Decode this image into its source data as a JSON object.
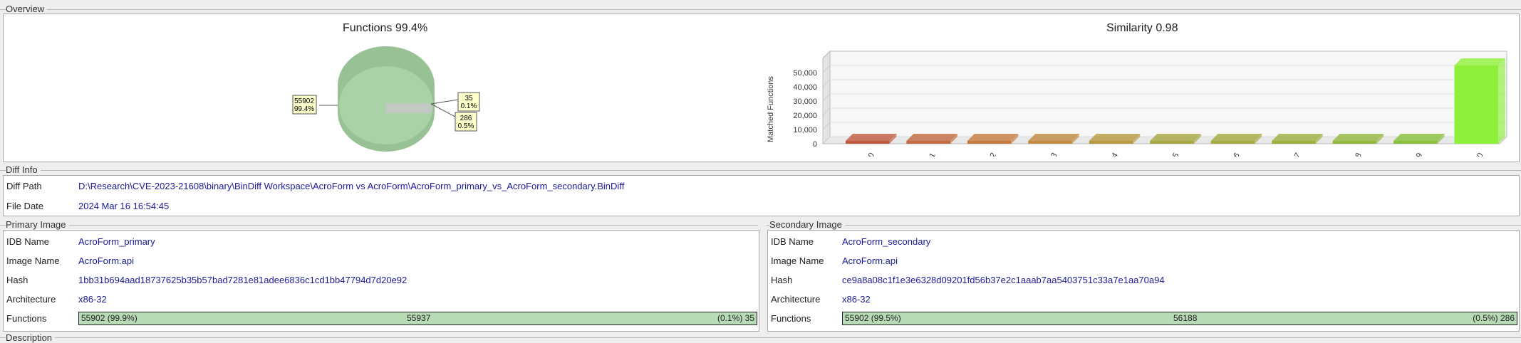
{
  "overview": {
    "section_title": "Overview",
    "functions_chart": {
      "title": "Functions 99.4%",
      "callouts": [
        {
          "count": "55902",
          "pct": "99.4%"
        },
        {
          "count": "35",
          "pct": "0.1%"
        },
        {
          "count": "286",
          "pct": "0.5%"
        }
      ]
    },
    "similarity_chart": {
      "title": "Similarity 0.98",
      "ylabel": "Matched Functions",
      "yticks": [
        "0",
        "10,000",
        "20,000",
        "30,000",
        "40,000",
        "50,000"
      ]
    }
  },
  "chart_data": [
    {
      "type": "pie",
      "title": "Functions 99.4%",
      "slices": [
        {
          "value": 55902,
          "percent": 99.4,
          "color": "#a9d3a6"
        },
        {
          "value": 35,
          "percent": 0.1,
          "color": "#c8c8c8"
        },
        {
          "value": 286,
          "percent": 0.5,
          "color": "#bdbdbd"
        }
      ]
    },
    {
      "type": "bar",
      "title": "Similarity 0.98",
      "ylabel": "Matched Functions",
      "categories": [
        "0.0",
        "0.1",
        "0.2",
        "0.3",
        "0.4",
        "0.5",
        "0.6",
        "0.7",
        "0.8",
        "0.9",
        "1.0"
      ],
      "values": [
        0,
        0,
        0,
        0,
        0,
        0,
        0,
        0,
        0,
        0,
        55000
      ],
      "ylim": [
        0,
        60000
      ],
      "colors": [
        "#c05a3e",
        "#c26a40",
        "#c57a40",
        "#c08a40",
        "#b89a42",
        "#a8a640",
        "#a4aa40",
        "#9cb03e",
        "#92b83c",
        "#88c03a",
        "#8ef03a"
      ],
      "grid": true
    }
  ],
  "diff_info": {
    "section_title": "Diff Info",
    "diff_path_label": "Diff Path",
    "diff_path": "D:\\Research\\CVE-2023-21608\\binary\\BinDiff Workspace\\AcroForm vs AcroForm\\AcroForm_primary_vs_AcroForm_secondary.BinDiff",
    "file_date_label": "File Date",
    "file_date": "2024 Mar 16 16:54:45"
  },
  "primary": {
    "section_title": "Primary Image",
    "idb_label": "IDB Name",
    "idb": "AcroForm_primary",
    "image_label": "Image Name",
    "image": "AcroForm.api",
    "hash_label": "Hash",
    "hash": "1bb31b694aad18737625b35b57bad7281e81adee6836c1cd1bb47794d7d20e92",
    "arch_label": "Architecture",
    "arch": "x86-32",
    "functions_label": "Functions",
    "functions_left": "55902 (99.9%)",
    "functions_mid": "55937",
    "functions_right": "(0.1%) 35"
  },
  "secondary": {
    "section_title": "Secondary Image",
    "idb_label": "IDB Name",
    "idb": "AcroForm_secondary",
    "image_label": "Image Name",
    "image": "AcroForm.api",
    "hash_label": "Hash",
    "hash": "ce9a8a08c1f1e3e6328d09201fd56b37e2c1aaab7aa5403751c33a7e1aa70a94",
    "arch_label": "Architecture",
    "arch": "x86-32",
    "functions_label": "Functions",
    "functions_left": "55902 (99.5%)",
    "functions_mid": "56188",
    "functions_right": "(0.5%) 286"
  },
  "description": {
    "section_title": "Description"
  }
}
